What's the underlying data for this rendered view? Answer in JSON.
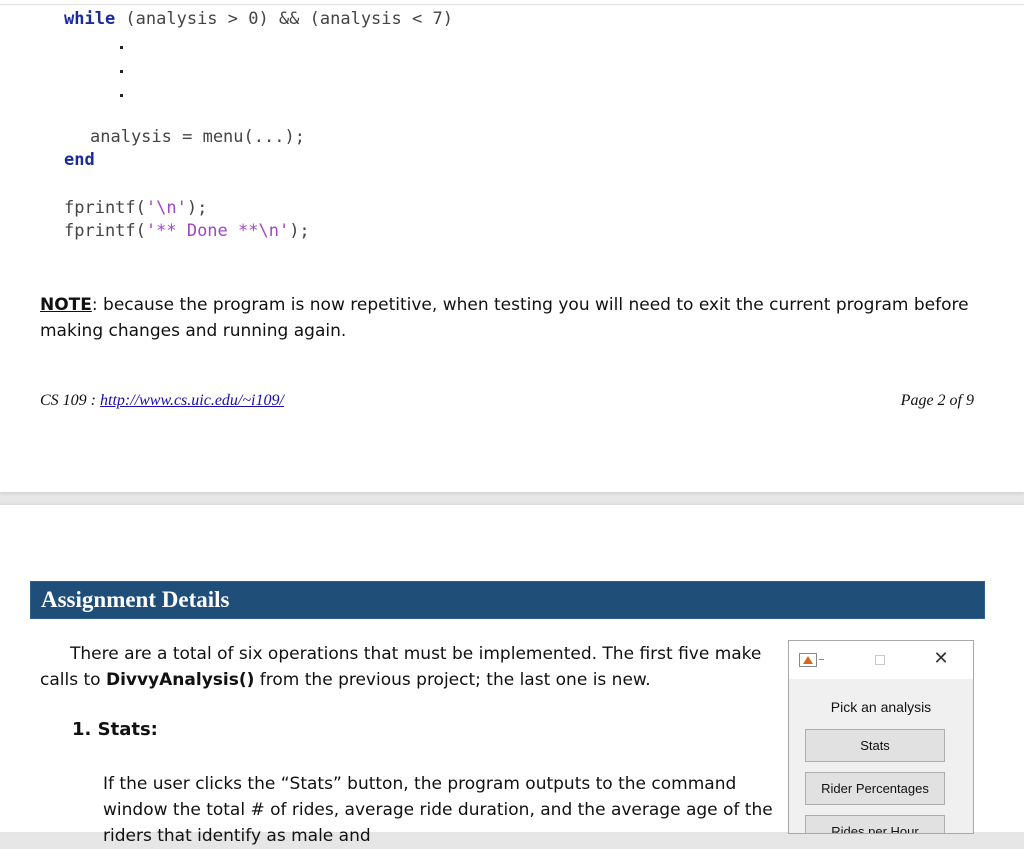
{
  "code": {
    "while_keyword": "while",
    "while_condition": " (analysis > 0) && (analysis < 7)",
    "assign_line": "analysis = menu(...);",
    "end_keyword": "end",
    "fprintf1_prefix": "fprintf(",
    "fprintf1_string": "'\\n'",
    "fprintf1_suffix": ");",
    "fprintf2_prefix": "fprintf(",
    "fprintf2_string": "'** Done **\\n'",
    "fprintf2_suffix": ");"
  },
  "note": {
    "label": "NOTE",
    "text": ": because the program is now repetitive, when testing you will need to exit the current program before making changes and running again."
  },
  "footer": {
    "course": "CS 109 : ",
    "url": "http://www.cs.uic.edu/~i109/",
    "page": "Page 2 of 9"
  },
  "section": {
    "title": "Assignment Details"
  },
  "intro": {
    "text_before": "There are a total of six operations that must be implemented.  The first five make calls to ",
    "function_name": "DivvyAnalysis()",
    "text_after": " from the previous project; the last one is new."
  },
  "stats": {
    "heading": "1.  Stats:",
    "description": "If the user clicks the “Stats” button, the program outputs to the command window the total # of rides, average ride duration, and the average age of the riders that identify as male and"
  },
  "dialog": {
    "prompt": "Pick an analysis",
    "close_glyph": "✕",
    "buttons": [
      "Stats",
      "Rider Percentages",
      "Rides per Hour"
    ]
  }
}
